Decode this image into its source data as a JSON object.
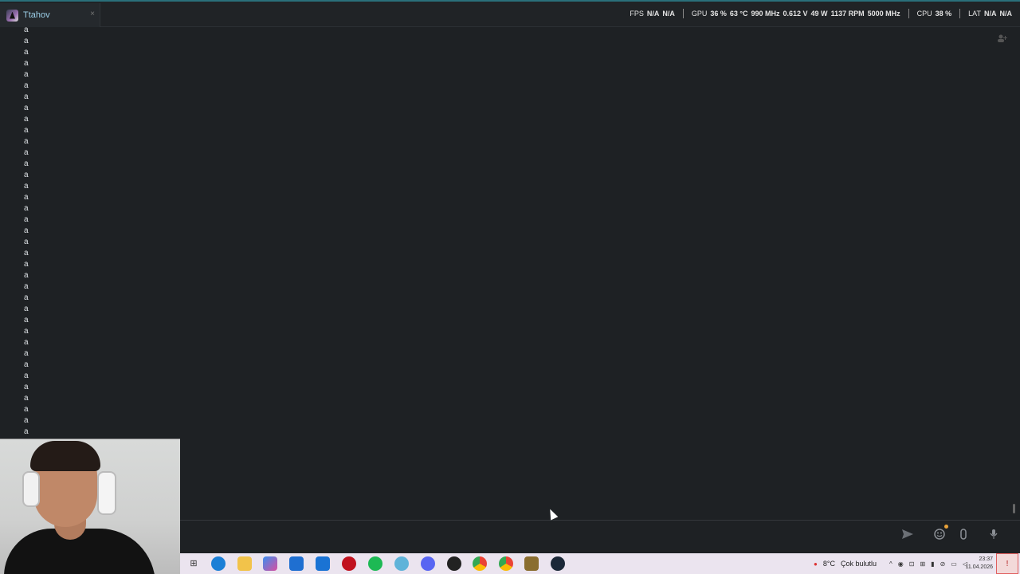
{
  "window": {
    "tab_title": "Ttahov",
    "tab_close": "×"
  },
  "stats": {
    "fps_label": "FPS",
    "fps_values": [
      "N/A",
      "N/A"
    ],
    "gpu_label": "GPU",
    "gpu_values": [
      "36 %",
      "63 °C",
      "990 MHz",
      "0.612 V",
      "49 W",
      "1137 RPM",
      "5000 MHz"
    ],
    "cpu_label": "CPU",
    "cpu_value": "38 %",
    "lat_label": "LAT",
    "lat_values": [
      "N/A",
      "N/A"
    ]
  },
  "chat": {
    "messages": [
      "a",
      "a",
      "a",
      "a",
      "a",
      "a",
      "a",
      "a",
      "a",
      "a",
      "a",
      "a",
      "a",
      "a",
      "a",
      "a",
      "a",
      "a",
      "a",
      "a",
      "a",
      "a",
      "a",
      "a",
      "a",
      "a",
      "a",
      "a",
      "a",
      "a",
      "a",
      "a",
      "a",
      "a",
      "a",
      "a",
      "a"
    ]
  },
  "composer": {
    "send_icon": "send-icon",
    "emoji_icon": "emoji-icon",
    "attach_icon": "attach-icon",
    "mic_icon": "mic-icon"
  },
  "taskbar": {
    "weather_temp": "8°C",
    "weather_desc": "Çok bulutlu",
    "time": "23:37",
    "date": "11.04.2026",
    "accent_color": "#2a6f7a"
  }
}
